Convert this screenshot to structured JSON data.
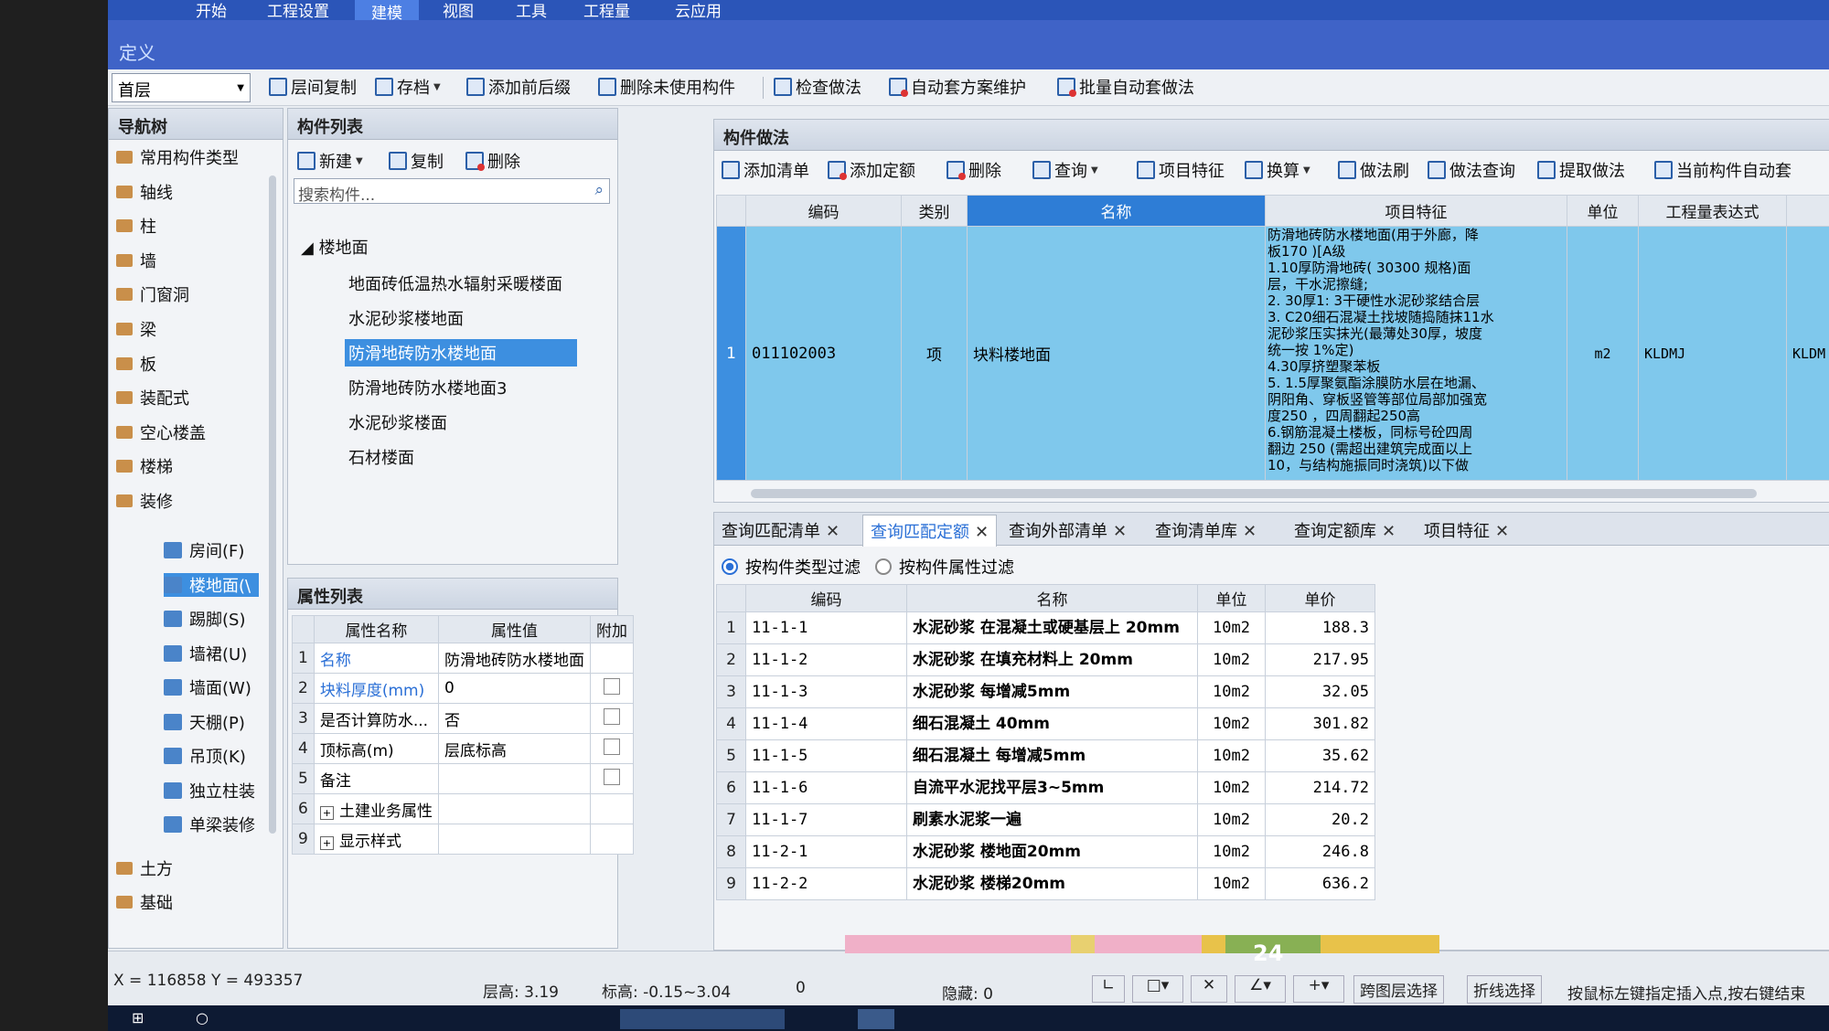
{
  "menu": {
    "items": [
      "开始",
      "工程设置",
      "建模",
      "视图",
      "工具",
      "工程量",
      "云应用"
    ]
  },
  "define_title": "定义",
  "toolbar": {
    "floor": "首层",
    "buttons": [
      "层间复制",
      "存档",
      "添加前后缀",
      "删除未使用构件",
      "检查做法",
      "自动套方案维护",
      "批量自动套做法"
    ]
  },
  "nav": {
    "title": "导航树",
    "items": [
      "常用构件类型",
      "轴线",
      "柱",
      "墙",
      "门窗洞",
      "梁",
      "板",
      "装配式",
      "空心楼盖",
      "楼梯",
      "装修"
    ],
    "sub_items": [
      "房间(F)",
      "楼地面(\\",
      "踢脚(S)",
      "墙裙(U)",
      "墙面(W)",
      "天棚(P)",
      "吊顶(K)",
      "独立柱装",
      "单梁装修"
    ],
    "bottom_items": [
      "土方",
      "基础"
    ]
  },
  "component_list": {
    "title": "构件列表",
    "buttons": [
      "新建",
      "复制",
      "删除"
    ],
    "search_placeholder": "搜索构件...",
    "group": "楼地面",
    "items": [
      "地面砖低温热水辐射采暖楼面",
      "水泥砂浆楼地面",
      "防滑地砖防水楼地面",
      "防滑地砖防水楼地面3",
      "水泥砂浆楼面",
      "石材楼面"
    ]
  },
  "properties": {
    "title": "属性列表",
    "headers": [
      "属性名称",
      "属性值",
      "附加"
    ],
    "rows": [
      {
        "n": "1",
        "name": "名称",
        "value": "防滑地砖防水楼地面"
      },
      {
        "n": "2",
        "name": "块料厚度(mm)",
        "value": "0"
      },
      {
        "n": "3",
        "name": "是否计算防水...",
        "value": "否"
      },
      {
        "n": "4",
        "name": "顶标高(m)",
        "value": "层底标高"
      },
      {
        "n": "5",
        "name": "备注",
        "value": ""
      },
      {
        "n": "6",
        "name": "土建业务属性",
        "value": ""
      },
      {
        "n": "9",
        "name": "显示样式",
        "value": ""
      }
    ]
  },
  "method": {
    "title": "构件做法",
    "buttons": [
      "添加清单",
      "添加定额",
      "删除",
      "查询",
      "项目特征",
      "换算",
      "做法刷",
      "做法查询",
      "提取做法",
      "当前构件自动套"
    ],
    "headers": [
      "编码",
      "类别",
      "名称",
      "项目特征",
      "单位",
      "工程量表达式"
    ],
    "row": {
      "n": "1",
      "code": "011102003",
      "type": "项",
      "name": "块料楼地面",
      "unit": "m2",
      "expr": "KLDMJ",
      "expr2": "KLDM",
      "feature_lines": [
        "防滑地砖防水楼地面(用于外廊，降",
        "板170 )[A级",
        "1.10厚防滑地砖( 30300 规格)面",
        "层，干水泥擦缝;",
        "2. 30厚1: 3干硬性水泥砂浆结合层",
        "3. C20细石混凝土找坡随捣随抹11水",
        "泥砂浆压实抹光(最薄处30厚，坡度",
        "统一按 1%定)",
        "4.30厚挤塑聚苯板",
        "5. 1.5厚聚氨酯涂膜防水层在地漏、",
        "阴阳角、穿板竖管等部位局部加强宽",
        "度250 ，四周翻起250高",
        "6.钢筋混凝土楼板，同标号砼四周",
        "翻边 250 (需超出建筑完成面以上",
        "10，与结构施振同时浇筑)以下做"
      ]
    }
  },
  "query": {
    "tabs": [
      "查询匹配清单",
      "查询匹配定额",
      "查询外部清单",
      "查询清单库",
      "查询定额库",
      "项目特征"
    ],
    "filter1": "按构件类型过滤",
    "filter2": "按构件属性过滤",
    "headers": [
      "编码",
      "名称",
      "单位",
      "单价"
    ],
    "rows": [
      [
        "1",
        "11-1-1",
        "水泥砂浆 在混凝土或硬基层上 20mm",
        "10m2",
        "188.3"
      ],
      [
        "2",
        "11-1-2",
        "水泥砂浆 在填充材料上 20mm",
        "10m2",
        "217.95"
      ],
      [
        "3",
        "11-1-3",
        "水泥砂浆 每增减5mm",
        "10m2",
        "32.05"
      ],
      [
        "4",
        "11-1-4",
        "细石混凝土 40mm",
        "10m2",
        "301.82"
      ],
      [
        "5",
        "11-1-5",
        "细石混凝土 每增减5mm",
        "10m2",
        "35.62"
      ],
      [
        "6",
        "11-1-6",
        "自流平水泥找平层3~5mm",
        "10m2",
        "214.72"
      ],
      [
        "7",
        "11-1-7",
        "刷素水泥浆一遍",
        "10m2",
        "20.2"
      ],
      [
        "8",
        "11-2-1",
        "水泥砂浆 楼地面20mm",
        "10m2",
        "246.8"
      ],
      [
        "9",
        "11-2-2",
        "水泥砂浆 楼梯20mm",
        "10m2",
        "636.2"
      ]
    ]
  },
  "status": {
    "coords": "X = 116858 Y = 493357",
    "floor_height": "层高: 3.19",
    "elevation": "标高: -0.15~3.04",
    "zero": "0",
    "hidden": "隐藏: 0",
    "btn1": "跨图层选择",
    "btn2": "折线选择",
    "hint": "按鼠标左键指定插入点,按右键结束",
    "badge": "24"
  }
}
